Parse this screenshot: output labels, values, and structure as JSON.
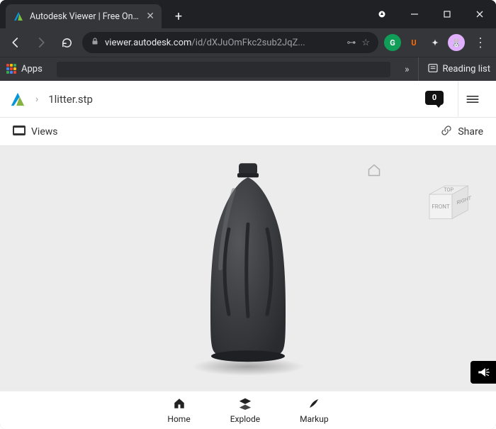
{
  "browser": {
    "tab_title": "Autodesk Viewer | Free Online Fil",
    "url_host": "viewer.autodesk.com",
    "url_path": "/id/dXJuOmFkc2sub2JqZ...",
    "apps_label": "Apps",
    "reading_list_label": "Reading list"
  },
  "app": {
    "filename": "1litter.stp",
    "comments_count": "0",
    "views_label": "Views",
    "share_label": "Share"
  },
  "viewer": {
    "cube": {
      "front": "FRONT",
      "right": "RIGHT",
      "top": "TOP"
    }
  },
  "toolbar": {
    "items": [
      {
        "label": "Home"
      },
      {
        "label": "Explode"
      },
      {
        "label": "Markup"
      }
    ]
  }
}
